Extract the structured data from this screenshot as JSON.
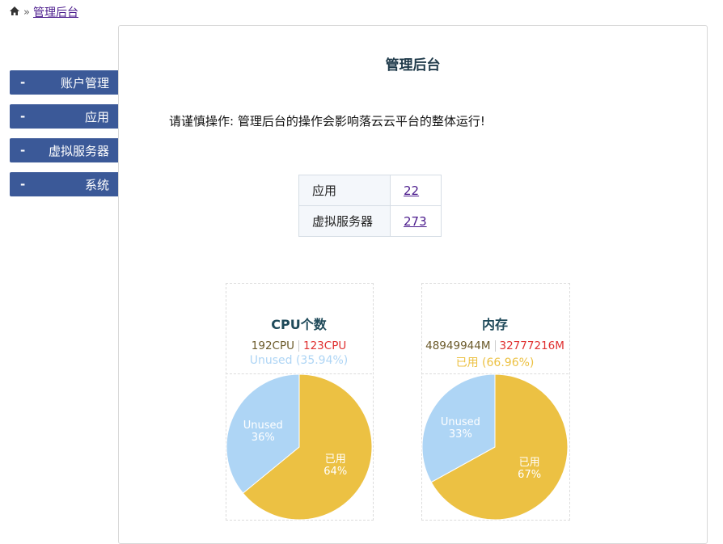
{
  "breadcrumb": {
    "home_icon": "home-icon",
    "separator": "»",
    "current": "管理后台"
  },
  "sidebar": {
    "items": [
      {
        "dash": "-",
        "label": "账户管理"
      },
      {
        "dash": "-",
        "label": "应用"
      },
      {
        "dash": "-",
        "label": "虚拟服务器"
      },
      {
        "dash": "-",
        "label": "系统"
      }
    ]
  },
  "main": {
    "title": "管理后台",
    "warning": "请谨慎操作: 管理后台的操作会影响落云云平台的整体运行!",
    "stats": [
      {
        "label": "应用",
        "value": "22"
      },
      {
        "label": "虚拟服务器",
        "value": "273"
      }
    ]
  },
  "colors": {
    "used": "#ecc143",
    "unused": "#aed5f5",
    "sidebar": "#3b5998",
    "free_text": "#e03030"
  },
  "chart_data": [
    {
      "type": "pie",
      "title": "CPU个数",
      "legend_used": "192CPU",
      "legend_free": "123CPU",
      "subtitle": "Unused (35.94%)",
      "subtitle_color": "#aed5f5",
      "slices": [
        {
          "name": "已用",
          "value": 64.06,
          "label": "64%",
          "color": "#ecc143"
        },
        {
          "name": "Unused",
          "value": 35.94,
          "label": "36%",
          "color": "#aed5f5"
        }
      ]
    },
    {
      "type": "pie",
      "title": "内存",
      "legend_used": "48949944M",
      "legend_free": "32777216M",
      "subtitle": "已用 (66.96%)",
      "subtitle_color": "#ecc143",
      "slices": [
        {
          "name": "已用",
          "value": 66.96,
          "label": "67%",
          "color": "#ecc143"
        },
        {
          "name": "Unused",
          "value": 33.04,
          "label": "33%",
          "color": "#aed5f5"
        }
      ]
    }
  ]
}
